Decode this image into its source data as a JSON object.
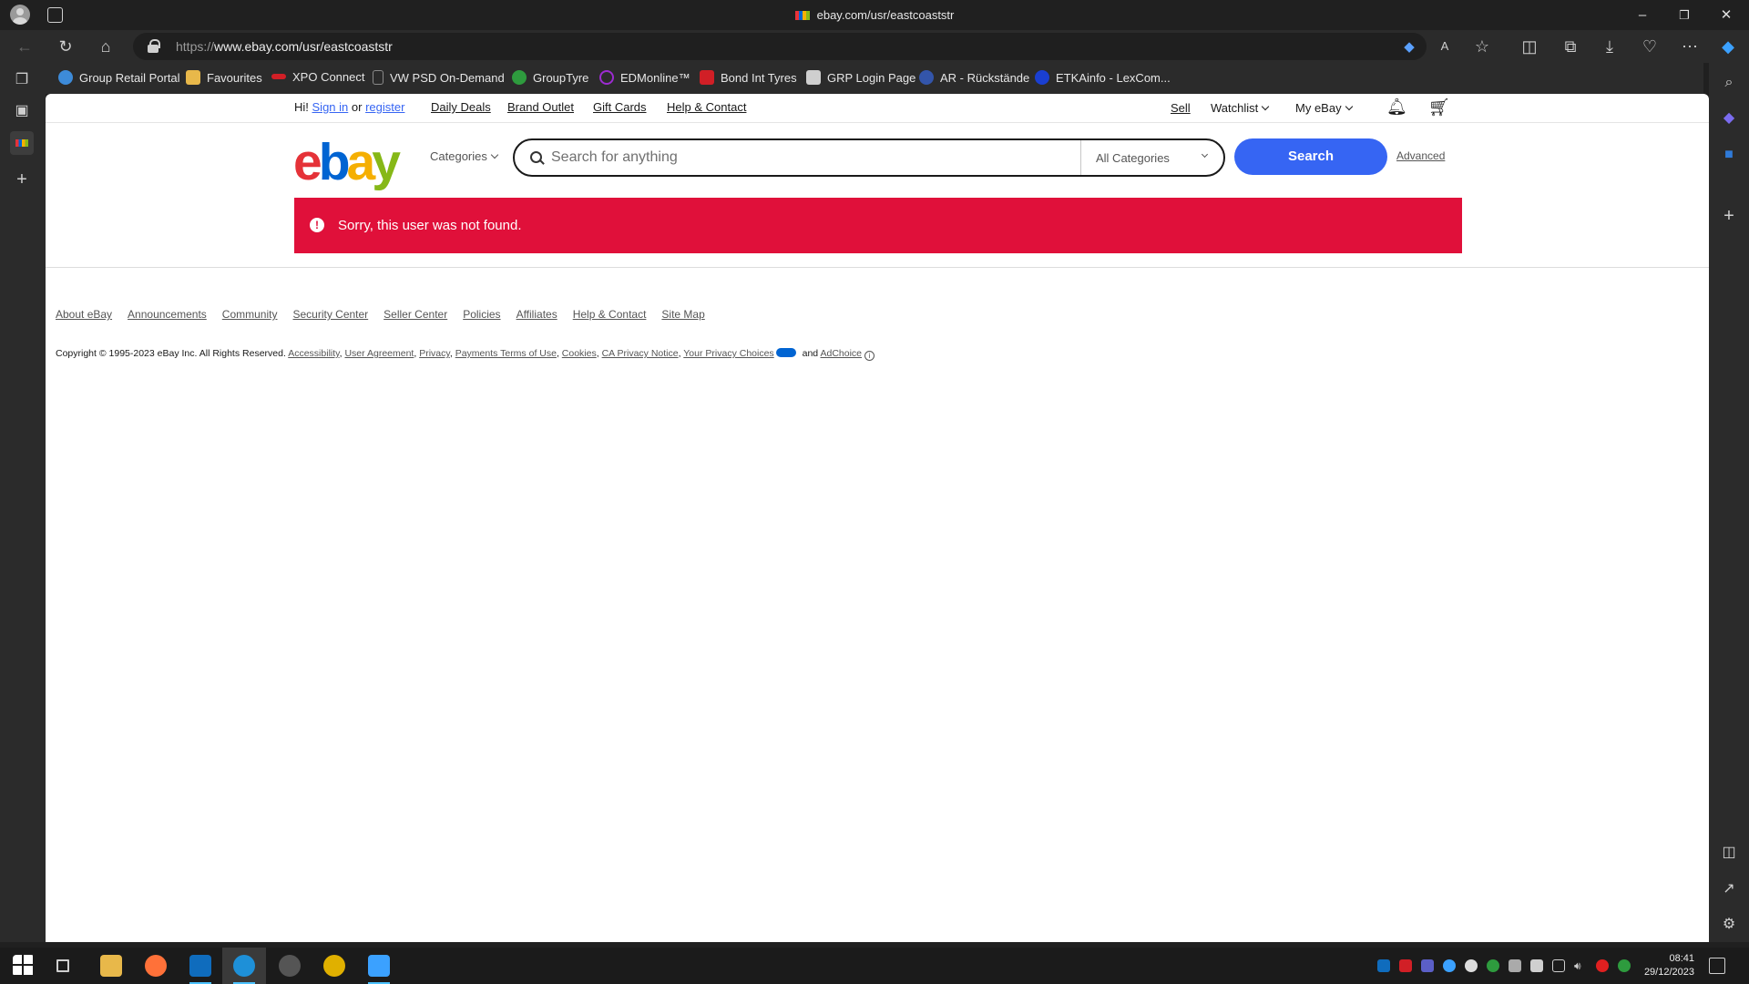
{
  "browser": {
    "tab_title": "ebay.com/usr/eastcoaststr",
    "url_prefix": "https://",
    "url_host": "www.ebay.com",
    "url_path": "/usr/eastcoaststr",
    "window_controls": {
      "minimize": "–",
      "maximize": "❐",
      "close": "✕"
    }
  },
  "favorites": [
    {
      "label": "Group Retail Portal",
      "icon": "globe-icon",
      "color": "#3d8bd9"
    },
    {
      "label": "Favourites",
      "icon": "folder-icon",
      "color": "#e8b84a"
    },
    {
      "label": "XPO Connect",
      "icon": "xpo-icon",
      "color": "#d11f26"
    },
    {
      "label": "VW PSD On-Demand",
      "icon": "vw-icon",
      "color": "#8a8a8a"
    },
    {
      "label": "GroupTyre",
      "icon": "grouptyre-icon",
      "color": "#2e9b3e"
    },
    {
      "label": "EDMonline™",
      "icon": "edm-icon",
      "color": "#9c2bd1"
    },
    {
      "label": "Bond Int Tyres",
      "icon": "bond-icon",
      "color": "#d11f26"
    },
    {
      "label": "GRP Login Page",
      "icon": "grp-icon",
      "color": "#cfcfcf"
    },
    {
      "label": "AR - Rückstände",
      "icon": "vw-logo-icon",
      "color": "#3355aa"
    },
    {
      "label": "ETKAinfo - LexCom...",
      "icon": "etka-icon",
      "color": "#1a3fd1"
    }
  ],
  "ebay": {
    "greeting": "Hi!",
    "sign_in": "Sign in",
    "or": "or",
    "register": "register",
    "nav_links": [
      "Daily Deals",
      "Brand Outlet",
      "Gift Cards",
      "Help & Contact"
    ],
    "sell": "Sell",
    "watchlist": "Watchlist",
    "my_ebay": "My eBay",
    "logo": {
      "e": "e",
      "b": "b",
      "a": "a",
      "y": "y"
    },
    "categories_label": "Categories",
    "search_placeholder": "Search for anything",
    "category_select": "All Categories",
    "search_button": "Search",
    "advanced": "Advanced",
    "alert_message": "Sorry, this user was not found.",
    "alert_icon": "!",
    "footer_links": [
      "About eBay",
      "Announcements",
      "Community",
      "Security Center",
      "Seller Center",
      "Policies",
      "Affiliates",
      "Help & Contact",
      "Site Map"
    ],
    "copyright_text": "Copyright © 1995-2023 eBay Inc. All Rights Reserved.",
    "legal_links": [
      "Accessibility",
      "User Agreement",
      "Privacy",
      "Payments Terms of Use",
      "Cookies",
      "CA Privacy Notice",
      "Your Privacy Choices"
    ],
    "and": "and",
    "adchoice": "AdChoice",
    "adchoice_info": "i"
  },
  "taskbar": {
    "time": "08:41",
    "date": "29/12/2023"
  },
  "colors": {
    "ebay_blue": "#3665f3",
    "alert_red": "#e0103a",
    "logo_red": "#e53238",
    "logo_blue": "#0064d2",
    "logo_yellow": "#f5af02",
    "logo_green": "#86b817"
  }
}
